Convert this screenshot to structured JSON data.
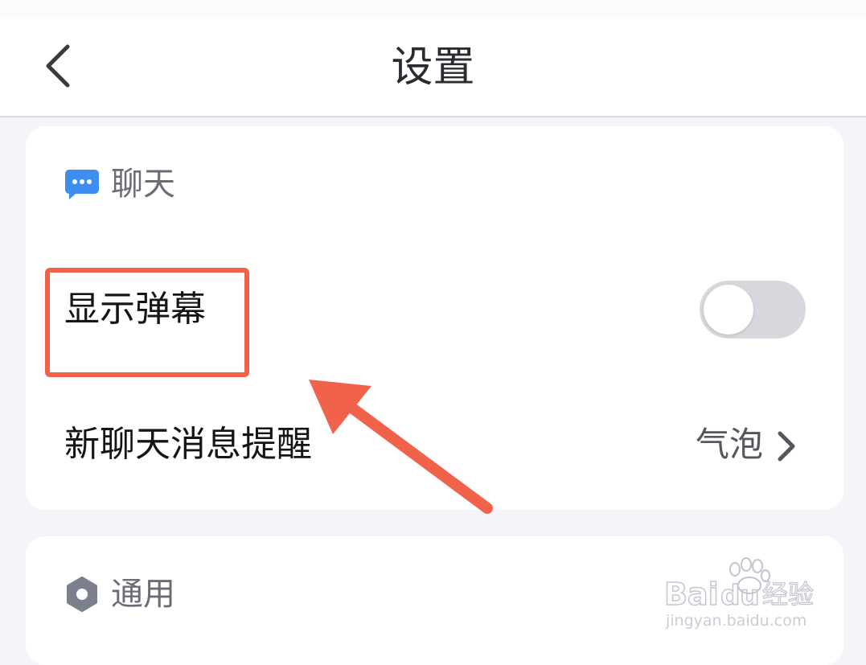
{
  "header": {
    "title": "设置"
  },
  "chat_section": {
    "title": "聊天",
    "rows": [
      {
        "label": "显示弹幕",
        "toggle_on": false
      },
      {
        "label": "新聊天消息提醒",
        "value": "气泡"
      }
    ]
  },
  "general_section": {
    "title": "通用"
  },
  "watermark": {
    "brand": "Bai",
    "brand2": "du",
    "suffix": "经验",
    "url": "jingyan.baidu.com"
  },
  "colors": {
    "accent_blue": "#3d8ef0",
    "highlight_red": "#f1624a",
    "toggle_off": "#d6d8dd",
    "gear_gray": "#7c7f8c"
  }
}
